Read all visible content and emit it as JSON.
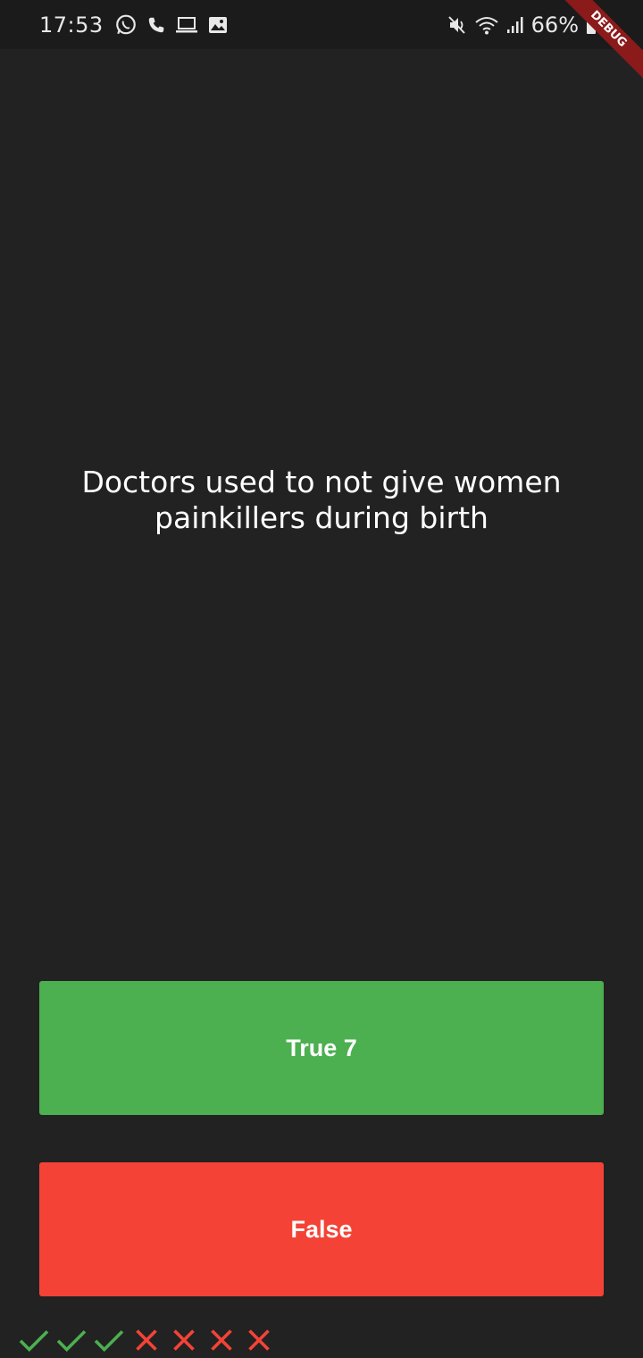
{
  "status_bar": {
    "time": "17:53",
    "battery": "66%",
    "left_icons": [
      "whatsapp-icon",
      "phone-icon",
      "laptop-icon",
      "image-icon"
    ],
    "right_icons": [
      "mute-icon",
      "wifi-icon",
      "signal-icon",
      "battery-icon"
    ]
  },
  "debug_banner": "DEBUG",
  "quiz": {
    "question": "Doctors used to not give women painkillers during birth",
    "true_label": "True 7",
    "false_label": "False"
  },
  "score": {
    "marks": [
      "correct",
      "correct",
      "correct",
      "wrong",
      "wrong",
      "wrong",
      "wrong"
    ]
  },
  "colors": {
    "background": "#222222",
    "true_button": "#4caf50",
    "false_button": "#f44336",
    "check": "#4caf50",
    "cross": "#f44336"
  }
}
